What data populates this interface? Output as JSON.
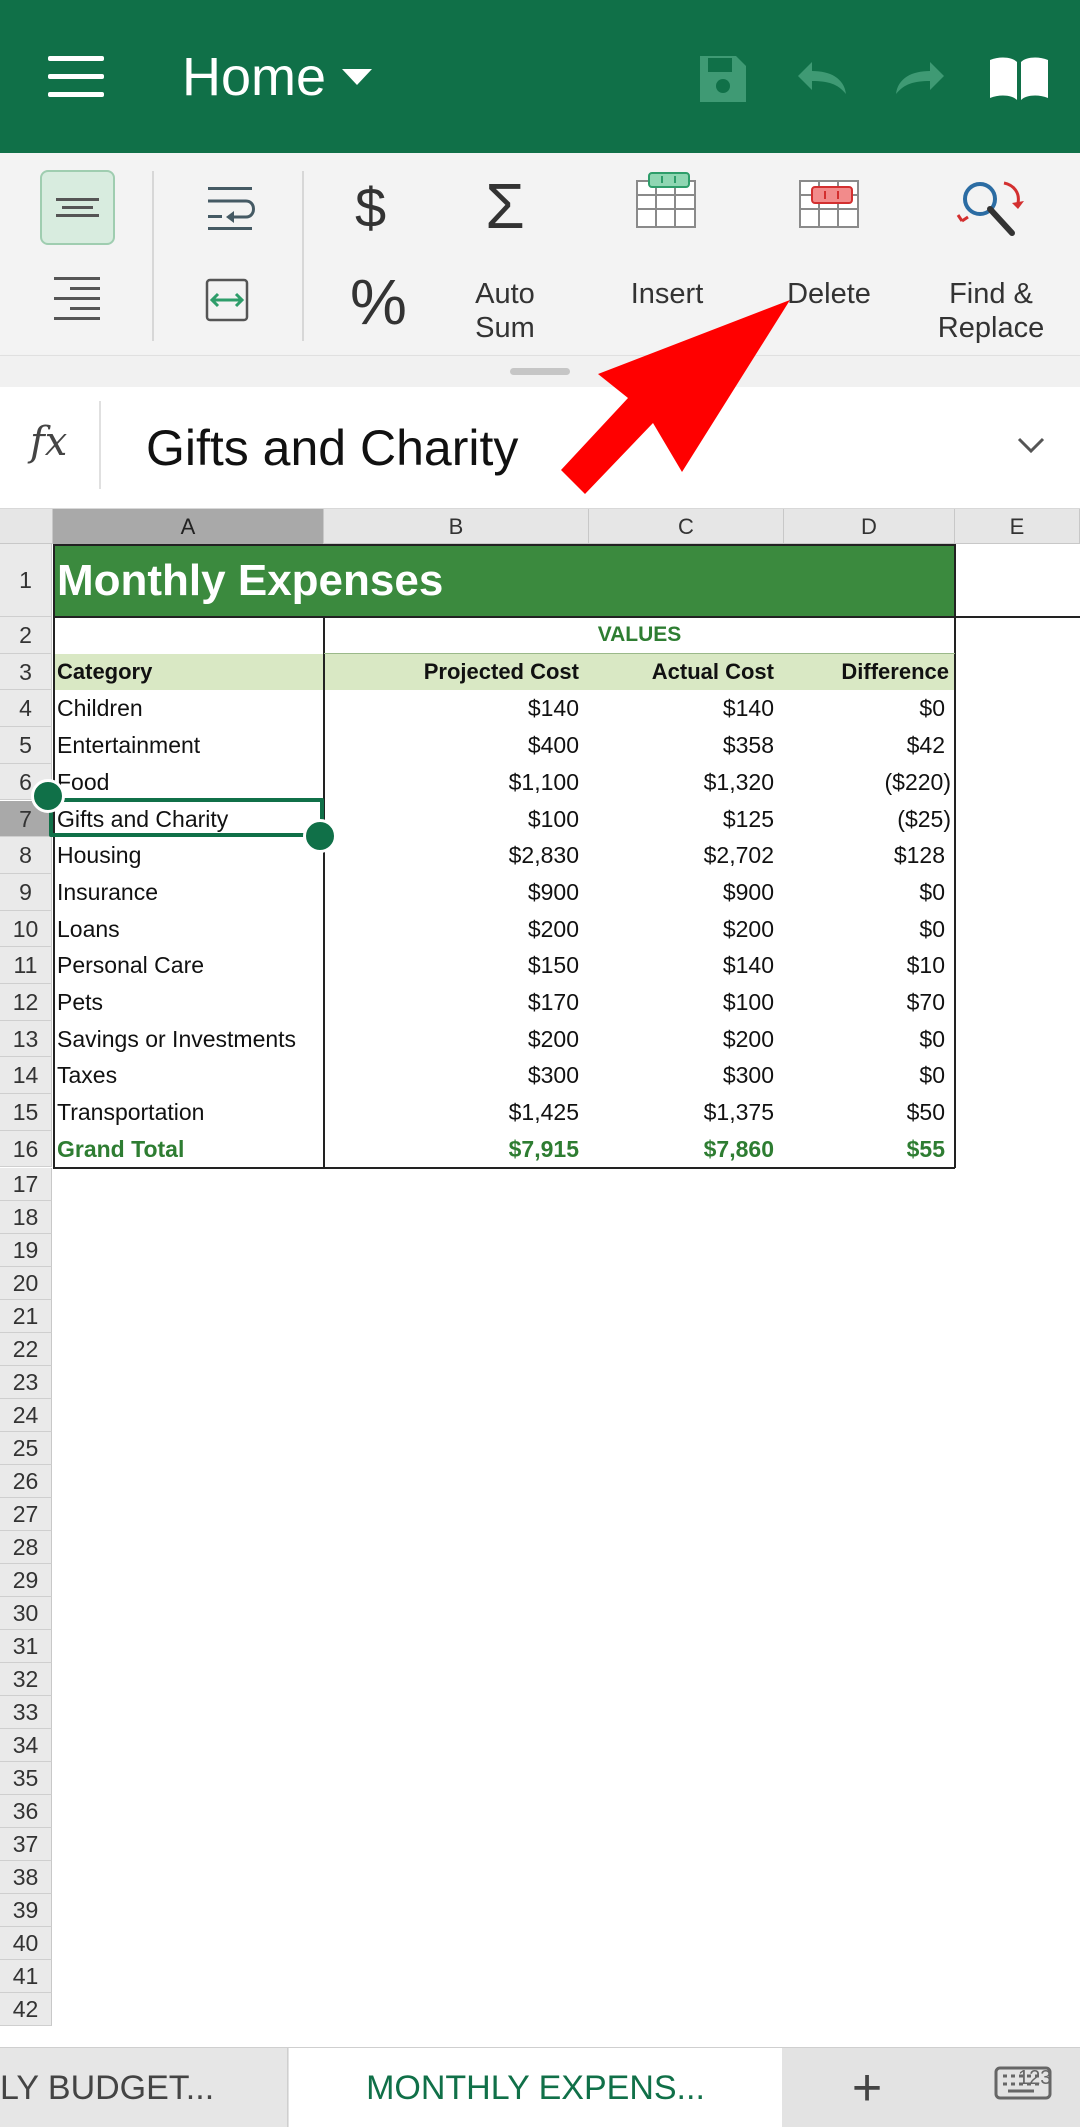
{
  "topbar": {
    "title": "Home",
    "brand_color": "#107048"
  },
  "ribbon": {
    "auto_sum_label_1": "Auto",
    "auto_sum_label_2": "Sum",
    "insert_label": "Insert",
    "delete_label": "Delete",
    "find_label_1": "Find &",
    "find_label_2": "Replace",
    "dollar_symbol": "$",
    "percent_symbol": "%",
    "sigma_symbol": "Σ"
  },
  "formula_bar": {
    "fx": "fx",
    "value": "Gifts and Charity"
  },
  "columns": [
    "A",
    "B",
    "C",
    "D",
    "E"
  ],
  "rows": [
    "1",
    "2",
    "3",
    "4",
    "5",
    "6",
    "7",
    "8",
    "9",
    "10",
    "11",
    "12",
    "13",
    "14",
    "15",
    "16",
    "17",
    "18",
    "19",
    "20",
    "21",
    "22",
    "23",
    "24",
    "25",
    "26",
    "27",
    "28",
    "29",
    "30",
    "31",
    "32",
    "33",
    "34",
    "35",
    "36",
    "37",
    "38",
    "39",
    "40",
    "41",
    "42"
  ],
  "sheet": {
    "title": "Monthly Expenses",
    "values_header": "VALUES",
    "headers": [
      "Category",
      "Projected Cost",
      "Actual Cost",
      "Difference"
    ],
    "data": [
      [
        "Children",
        "$140",
        "$140",
        "$0"
      ],
      [
        "Entertainment",
        "$400",
        "$358",
        "$42"
      ],
      [
        "Food",
        "$1,100",
        "$1,320",
        "($220)"
      ],
      [
        "Gifts and Charity",
        "$100",
        "$125",
        "($25)"
      ],
      [
        "Housing",
        "$2,830",
        "$2,702",
        "$128"
      ],
      [
        "Insurance",
        "$900",
        "$900",
        "$0"
      ],
      [
        "Loans",
        "$200",
        "$200",
        "$0"
      ],
      [
        "Personal Care",
        "$150",
        "$140",
        "$10"
      ],
      [
        "Pets",
        "$170",
        "$100",
        "$70"
      ],
      [
        "Savings or Investments",
        "$200",
        "$200",
        "$0"
      ],
      [
        "Taxes",
        "$300",
        "$300",
        "$0"
      ],
      [
        "Transportation",
        "$1,425",
        "$1,375",
        "$50"
      ]
    ],
    "total": [
      "Grand Total",
      "$7,915",
      "$7,860",
      "$55"
    ]
  },
  "tabs": {
    "tab1": "LY BUDGET...",
    "tab2": "MONTHLY EXPENS...",
    "add": "+",
    "keyboard_badge": "123"
  }
}
